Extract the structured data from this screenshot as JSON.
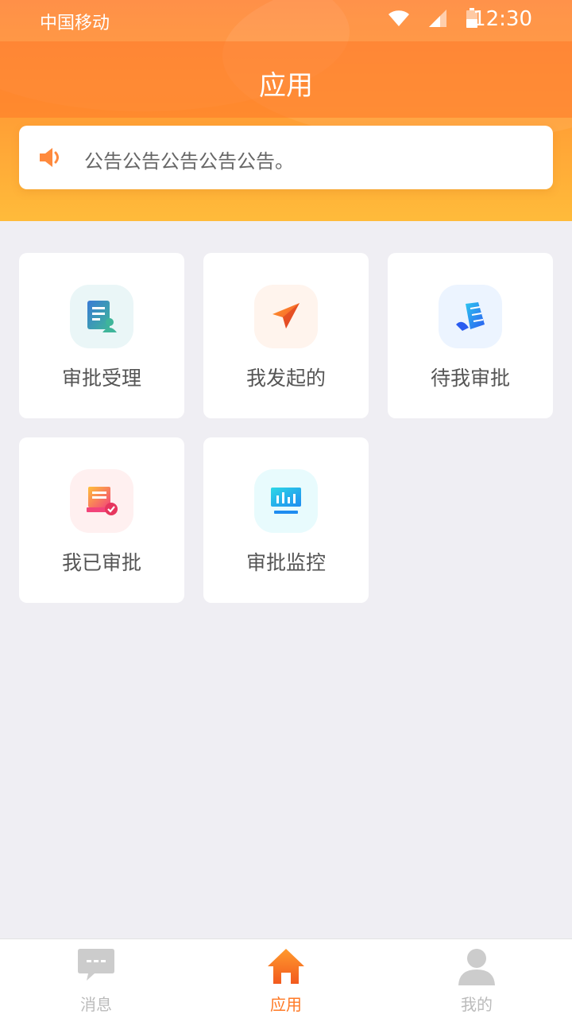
{
  "status_bar": {
    "carrier": "中国移动",
    "time": "12:30"
  },
  "header": {
    "title": "应用"
  },
  "notice": {
    "text": "公告公告公告公告公告。"
  },
  "apps": [
    {
      "label": "审批受理",
      "icon": "document-user-icon",
      "bg": "#eaf6f7"
    },
    {
      "label": "我发起的",
      "icon": "paper-plane-icon",
      "bg": "#fff4ed"
    },
    {
      "label": "待我审批",
      "icon": "book-stack-icon",
      "bg": "#ecf4ff"
    },
    {
      "label": "我已审批",
      "icon": "stamp-check-icon",
      "bg": "#fff0f0"
    },
    {
      "label": "审批监控",
      "icon": "monitor-chart-icon",
      "bg": "#e8fbfd"
    }
  ],
  "tabs": [
    {
      "label": "消息",
      "icon": "message-icon",
      "active": false
    },
    {
      "label": "应用",
      "icon": "home-icon",
      "active": true
    },
    {
      "label": "我的",
      "icon": "user-icon",
      "active": false
    }
  ],
  "colors": {
    "primary": "#ff7a26",
    "header_top": "#ff8a3d",
    "header_bottom": "#ffbb3a",
    "background": "#efeef3",
    "card": "#ffffff"
  }
}
